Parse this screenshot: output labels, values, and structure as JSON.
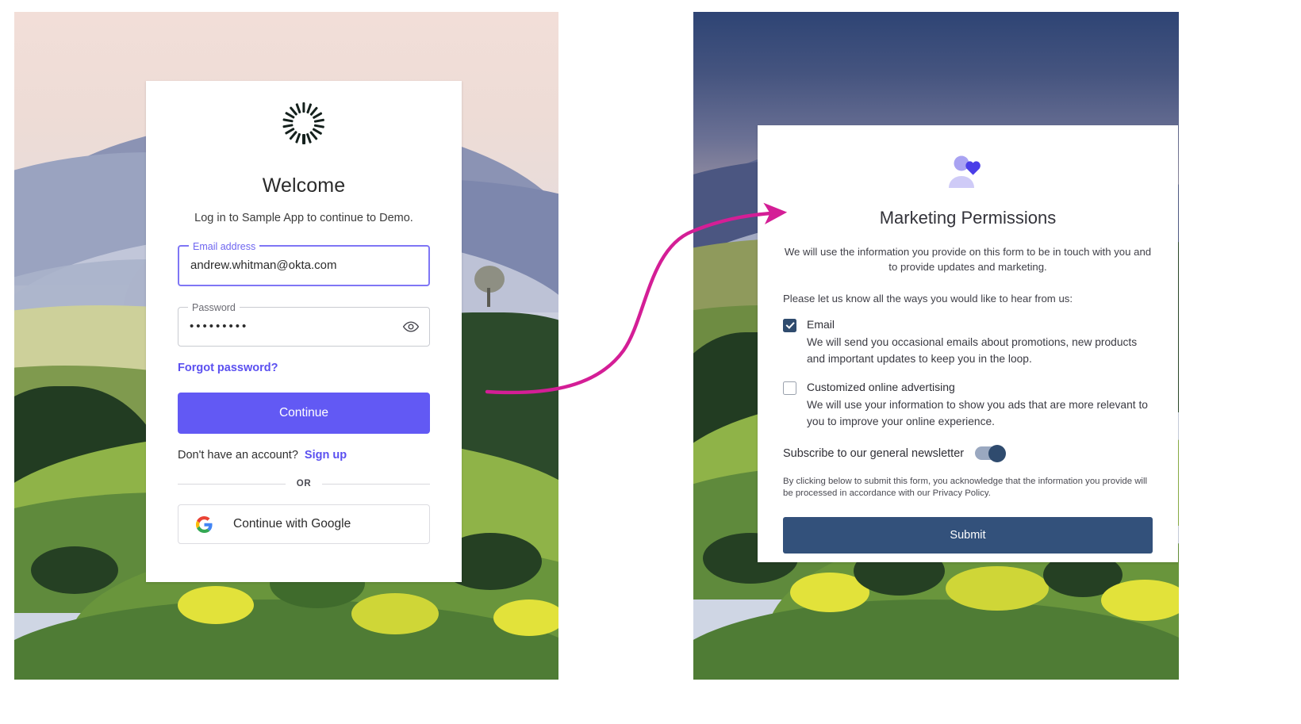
{
  "login": {
    "logo_icon": "okta-sunburst-logo",
    "heading": "Welcome",
    "subtitle": "Log in to Sample App to continue to Demo.",
    "email": {
      "label": "Email address",
      "value": "andrew.whitman@okta.com"
    },
    "password": {
      "label": "Password",
      "value": "•••••••••",
      "reveal_icon": "eye-icon"
    },
    "forgot_link": "Forgot password?",
    "primary_button": "Continue",
    "signup_prompt": "Don't have an account?",
    "signup_link": "Sign up",
    "divider": "OR",
    "google_button": "Continue with Google",
    "google_icon": "google-g-icon",
    "accent_color": "#6259f4",
    "link_color": "#5b50f0"
  },
  "consent": {
    "header_icon": "people-heart-icon",
    "title": "Marketing Permissions",
    "intro": "We will use the information you provide on this form to be in touch with you and to provide updates and marketing.",
    "prompt": "Please let us know all the ways you would like to hear from us:",
    "options": [
      {
        "title": "Email",
        "description": "We will send you occasional emails about promotions, new products and important updates to keep you in the loop.",
        "checked": true
      },
      {
        "title": "Customized online advertising",
        "description": "We will use your information to show you ads that are more relevant to you to improve your online experience.",
        "checked": false
      }
    ],
    "newsletter": {
      "label": "Subscribe to our general newsletter",
      "enabled": true
    },
    "legal": "By clicking below to submit this form, you acknowledge that the information you provide will be processed in accordance with our Privacy Policy.",
    "submit_button": "Submit",
    "accent_color": "#33517b"
  },
  "annotation": {
    "arrow_icon": "curved-flow-arrow",
    "arrow_color": "#d41e96"
  }
}
